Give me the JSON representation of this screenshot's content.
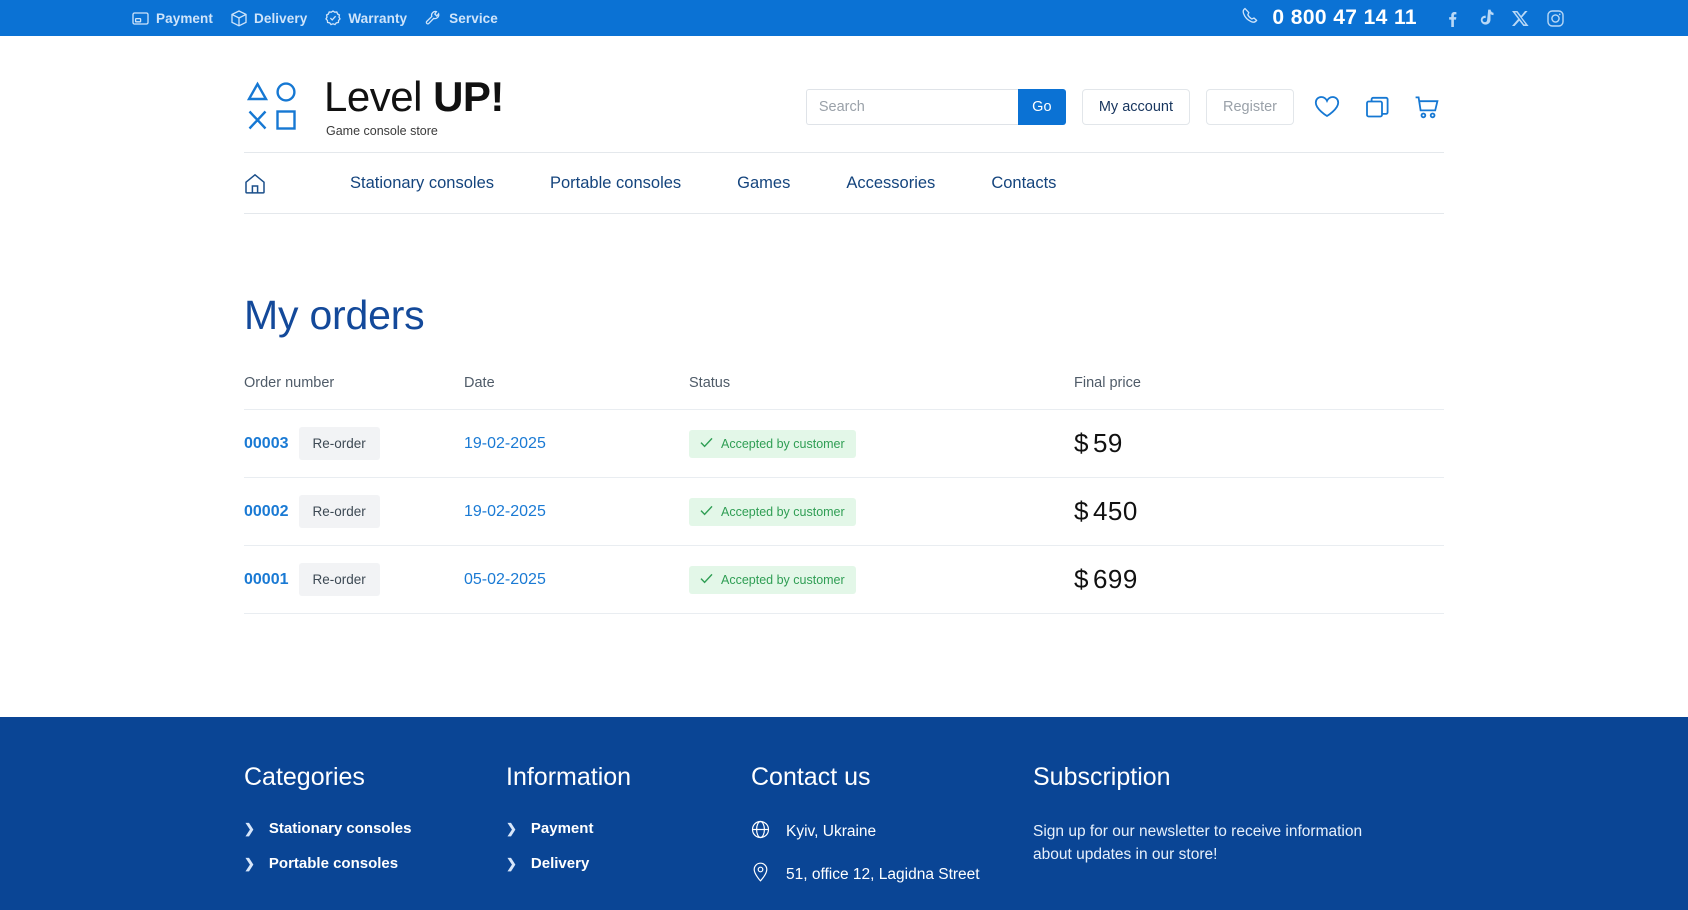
{
  "topbar": {
    "links": [
      {
        "label": "Payment",
        "icon": "card-icon"
      },
      {
        "label": "Delivery",
        "icon": "box-icon"
      },
      {
        "label": "Warranty",
        "icon": "badge-check-icon"
      },
      {
        "label": "Service",
        "icon": "wrench-icon"
      }
    ],
    "phone": "0 800 47 14 11",
    "socials": [
      "facebook-icon",
      "tiktok-icon",
      "x-icon",
      "instagram-icon"
    ],
    "bg_color": "#0b72d4"
  },
  "header": {
    "logo_title_thin": "Level ",
    "logo_title_bold": "UP!",
    "logo_subtitle": "Game console store",
    "search": {
      "value": "",
      "placeholder": "Search",
      "button": "Go"
    },
    "account_label": "My account",
    "register_label": "Register",
    "icons": [
      "heart-icon",
      "compare-icon",
      "cart-icon"
    ]
  },
  "nav": {
    "home_icon": "home-icon",
    "items": [
      "Stationary consoles",
      "Portable consoles",
      "Games",
      "Accessories",
      "Contacts"
    ]
  },
  "main": {
    "title": "My orders",
    "columns": [
      "Order number",
      "Date",
      "Status",
      "Final price"
    ],
    "reorder_label": "Re-order",
    "rows": [
      {
        "id": "00003",
        "date": "19-02-2025",
        "status": "Accepted by customer",
        "currency": "$",
        "price": "59"
      },
      {
        "id": "00002",
        "date": "19-02-2025",
        "status": "Accepted by customer",
        "currency": "$",
        "price": "450"
      },
      {
        "id": "00001",
        "date": "05-02-2025",
        "status": "Accepted by customer",
        "currency": "$",
        "price": "699"
      }
    ],
    "status_color": "#2f9e54",
    "status_bg": "#e3f7e8"
  },
  "footer": {
    "bg_color": "#0a4595",
    "categories": {
      "title": "Categories",
      "items": [
        "Stationary consoles",
        "Portable consoles"
      ]
    },
    "information": {
      "title": "Information",
      "items": [
        "Payment",
        "Delivery"
      ]
    },
    "contact": {
      "title": "Contact us",
      "items": [
        {
          "icon": "globe-icon",
          "text": "Kyiv, Ukraine"
        },
        {
          "icon": "pin-icon",
          "text": "51, office 12, Lagidna Street"
        }
      ]
    },
    "subscription": {
      "title": "Subscription",
      "text": "Sign up for our newsletter to receive information about updates in our store!"
    }
  }
}
